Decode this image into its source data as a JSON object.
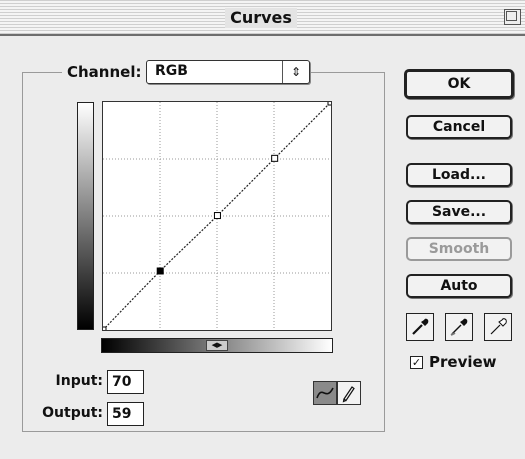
{
  "window": {
    "title": "Curves"
  },
  "channel": {
    "label": "Channel:",
    "value": "RGB",
    "arrow": "⇕"
  },
  "curve": {
    "points": [
      [
        0,
        0
      ],
      [
        64,
        66
      ],
      [
        128,
        128
      ],
      [
        192,
        192
      ],
      [
        255,
        255
      ]
    ],
    "control_points": [
      {
        "input": 0,
        "output": 0,
        "selected": false
      },
      {
        "input": 64,
        "output": 66,
        "selected": true
      },
      {
        "input": 128,
        "output": 128,
        "selected": false
      },
      {
        "input": 192,
        "output": 192,
        "selected": false
      },
      {
        "input": 255,
        "output": 255,
        "selected": false
      }
    ],
    "grid_divisions": 4
  },
  "io": {
    "input_label": "Input:",
    "input_value": "70",
    "output_label": "Output:",
    "output_value": "59"
  },
  "buttons": {
    "ok": "OK",
    "cancel": "Cancel",
    "load": "Load...",
    "save": "Save...",
    "smooth": "Smooth",
    "auto": "Auto"
  },
  "preview": {
    "label": "Preview",
    "checked": true,
    "check_glyph": "✓"
  },
  "gradient_toggle_glyph": "◀▶",
  "icons": {
    "curve_tool": "curve-icon",
    "pencil_tool": "pencil-icon",
    "eyedropper_black": "eyedropper-icon",
    "eyedropper_gray": "eyedropper-icon",
    "eyedropper_white": "eyedropper-icon"
  }
}
